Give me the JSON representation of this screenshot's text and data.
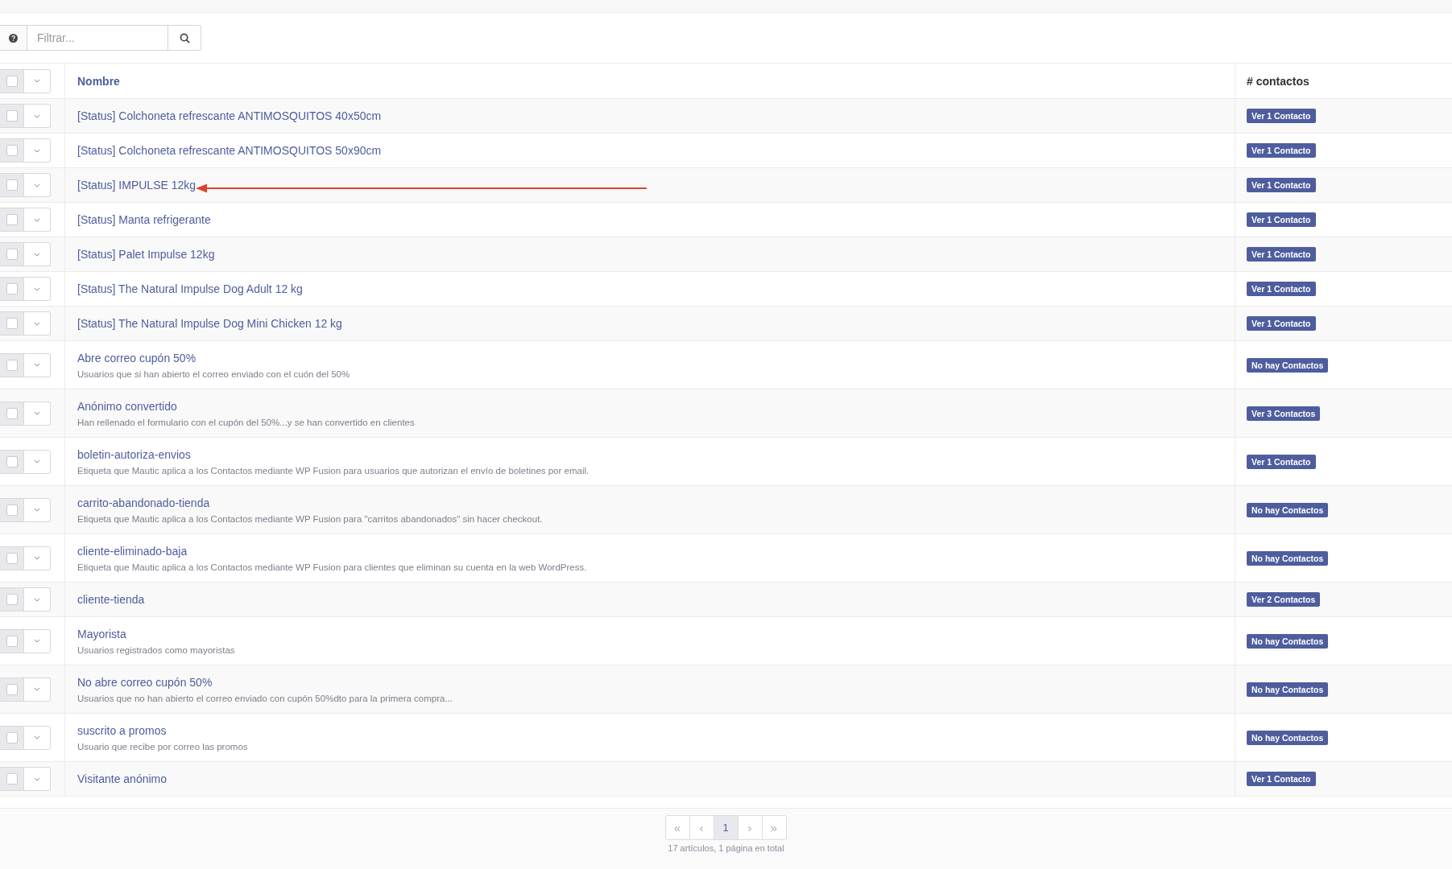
{
  "filter": {
    "placeholder": "Filtrar..."
  },
  "table": {
    "columns": [
      "Nombre",
      "# contactos"
    ],
    "header_checked": false,
    "rows": [
      {
        "name": "[Status] Colchoneta refrescante ANTIMOSQUITOS 40x50cm",
        "contacts": "Ver 1 Contacto",
        "checked": false,
        "arrow": false
      },
      {
        "name": "[Status] Colchoneta refrescante ANTIMOSQUITOS 50x90cm",
        "contacts": "Ver 1 Contacto",
        "checked": false,
        "arrow": false
      },
      {
        "name": "[Status] IMPULSE 12kg",
        "contacts": "Ver 1 Contacto",
        "checked": false,
        "arrow": true
      },
      {
        "name": "[Status] Manta refrigerante",
        "contacts": "Ver 1 Contacto",
        "checked": false,
        "arrow": false
      },
      {
        "name": "[Status] Palet Impulse 12kg",
        "contacts": "Ver 1 Contacto",
        "checked": false,
        "arrow": false
      },
      {
        "name": "[Status] The Natural Impulse Dog Adult 12 kg",
        "contacts": "Ver 1 Contacto",
        "checked": false,
        "arrow": false
      },
      {
        "name": "[Status] The Natural Impulse Dog Mini Chicken 12 kg",
        "contacts": "Ver 1 Contacto",
        "checked": false,
        "arrow": false
      },
      {
        "name": "Abre correo cupón 50%",
        "description": "Usuarios que si han abierto el correo enviado con el cuón del 50%",
        "contacts": "No hay Contactos",
        "checked": false,
        "arrow": false
      },
      {
        "name": "Anónimo convertido",
        "description": "Han rellenado el formulario con el cupón del 50%...y se han convertido en clientes",
        "contacts": "Ver 3 Contactos",
        "checked": false,
        "arrow": false
      },
      {
        "name": "boletin-autoriza-envios",
        "description": "Etiqueta que Mautic aplica a los Contactos mediante WP Fusion para usuarios que autorizan el envío de boletines por email.",
        "contacts": "Ver 1 Contacto",
        "checked": false,
        "arrow": false
      },
      {
        "name": "carrito-abandonado-tienda",
        "description": "Etiqueta que Mautic aplica a los Contactos mediante WP Fusion para \"carritos abandonados\" sin hacer checkout.",
        "contacts": "No hay Contactos",
        "checked": false,
        "arrow": false
      },
      {
        "name": "cliente-eliminado-baja",
        "description": "Etiqueta que Mautic aplica a los Contactos mediante WP Fusion para clientes que eliminan su cuenta en la web WordPress.",
        "contacts": "No hay Contactos",
        "checked": false,
        "arrow": false
      },
      {
        "name": "cliente-tienda",
        "contacts": "Ver 2 Contactos",
        "checked": false,
        "arrow": false
      },
      {
        "name": "Mayorista",
        "description": "Usuarios registrados como mayoristas",
        "contacts": "No hay Contactos",
        "checked": false,
        "arrow": false
      },
      {
        "name": "No abre correo cupón 50%",
        "description": "Usuarios que no han abierto el correo enviado con cupón 50%dto para la primera compra...",
        "contacts": "No hay Contactos",
        "checked": false,
        "arrow": false
      },
      {
        "name": "suscrito a promos",
        "description": "Usuario que recibe por correo las promos",
        "contacts": "No hay Contactos",
        "checked": false,
        "arrow": false
      },
      {
        "name": "Visitante anónimo",
        "contacts": "Ver 1 Contacto",
        "checked": false,
        "arrow": false
      }
    ]
  },
  "pagination": {
    "pages": [
      {
        "label": "«",
        "selected": false
      },
      {
        "label": "‹",
        "selected": false
      },
      {
        "label": "1",
        "selected": true
      },
      {
        "label": "›",
        "selected": false
      },
      {
        "label": "»",
        "selected": false
      }
    ],
    "summary": "17 artículos, 1 página en total"
  }
}
